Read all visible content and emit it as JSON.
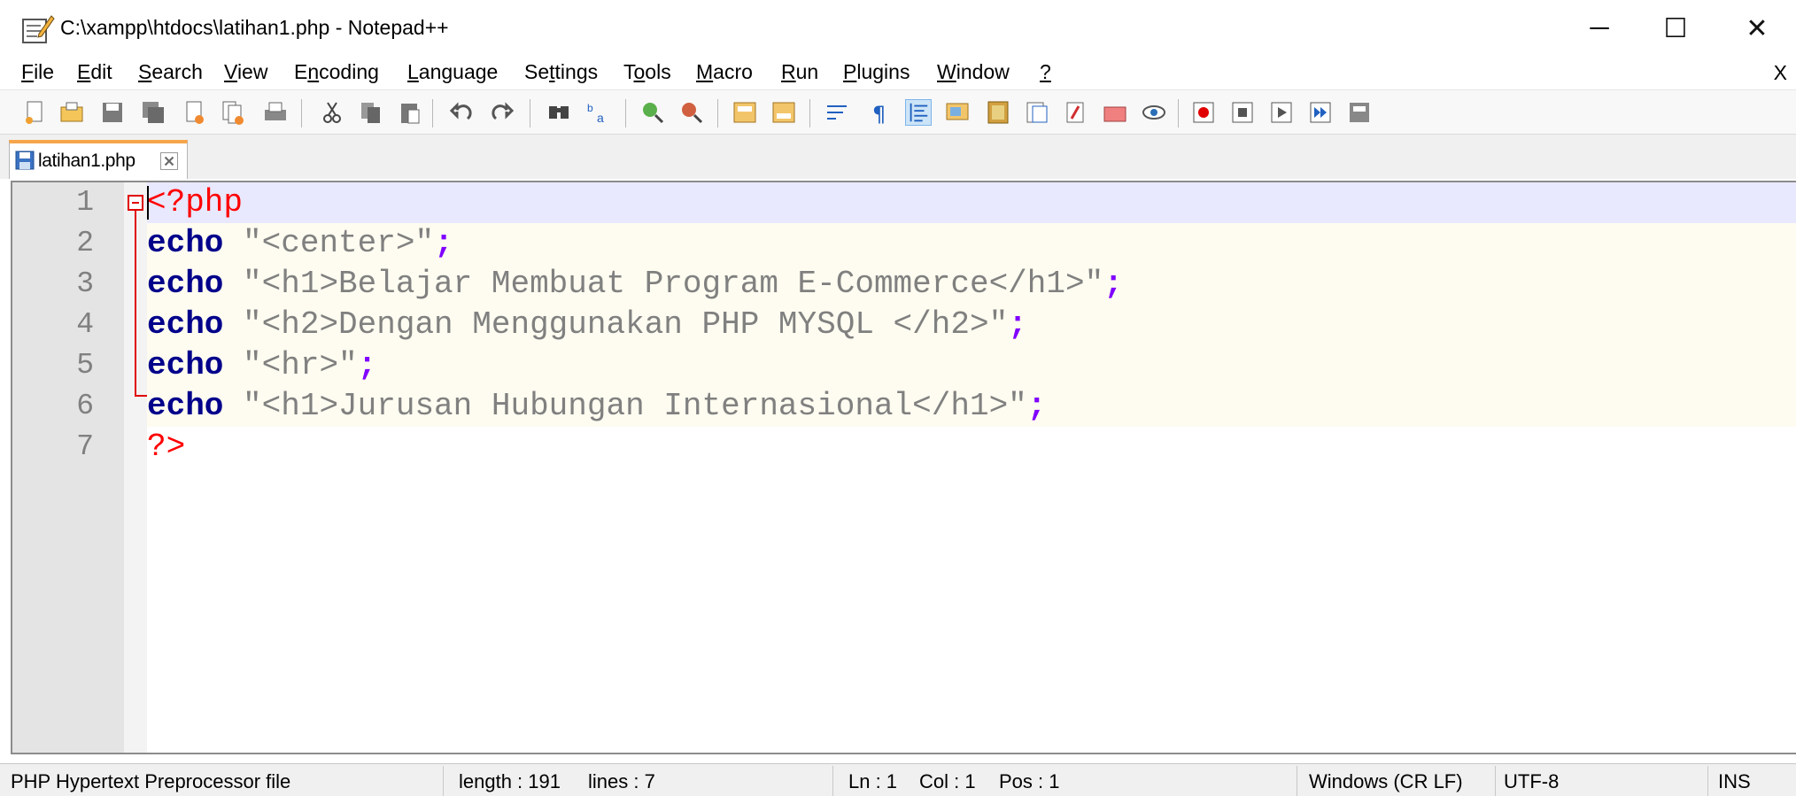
{
  "window": {
    "title": "C:\\xampp\\htdocs\\latihan1.php - Notepad++",
    "minimize_glyph": "─",
    "maximize_glyph": "☐",
    "close_glyph": "✕"
  },
  "menu": {
    "items": [
      {
        "pre": "",
        "u": "F",
        "post": "ile"
      },
      {
        "pre": "",
        "u": "E",
        "post": "dit"
      },
      {
        "pre": "",
        "u": "S",
        "post": "earch"
      },
      {
        "pre": "",
        "u": "V",
        "post": "iew"
      },
      {
        "pre": "E",
        "u": "n",
        "post": "coding"
      },
      {
        "pre": "",
        "u": "L",
        "post": "anguage"
      },
      {
        "pre": "Se",
        "u": "t",
        "post": "tings"
      },
      {
        "pre": "T",
        "u": "o",
        "post": "ols"
      },
      {
        "pre": "",
        "u": "M",
        "post": "acro"
      },
      {
        "pre": "",
        "u": "R",
        "post": "un"
      },
      {
        "pre": "",
        "u": "P",
        "post": "lugins"
      },
      {
        "pre": "",
        "u": "W",
        "post": "indow"
      },
      {
        "pre": "",
        "u": "?",
        "post": ""
      }
    ],
    "close_doc": "X"
  },
  "toolbar": {
    "icons": [
      "new-file-icon",
      "open-file-icon",
      "save-icon",
      "save-all-icon",
      "close-icon",
      "close-all-icon",
      "print-icon",
      "cut-icon",
      "copy-icon",
      "paste-icon",
      "undo-icon",
      "redo-icon",
      "find-icon",
      "replace-icon",
      "zoom-in-icon",
      "zoom-out-icon",
      "sync-vertical-icon",
      "sync-horizontal-icon",
      "word-wrap-icon",
      "show-all-characters-icon",
      "indent-guide-icon",
      "user-defined-language-icon",
      "document-map-icon",
      "function-list-icon",
      "folder-as-workspace-icon",
      "document-list-icon",
      "monitoring-icon",
      "record-macro-icon",
      "stop-macro-icon",
      "play-macro-icon",
      "run-macro-multiple-icon",
      "save-macro-icon"
    ]
  },
  "tab": {
    "label": "latihan1.php"
  },
  "editor": {
    "lines": [
      {
        "num": "1",
        "tokens": [
          {
            "t": "<?php",
            "c": "tag"
          }
        ]
      },
      {
        "num": "2",
        "tokens": [
          {
            "t": "echo",
            "c": "kw"
          },
          {
            "t": " \"<center>\"",
            "c": "str"
          },
          {
            "t": ";",
            "c": "op"
          }
        ]
      },
      {
        "num": "3",
        "tokens": [
          {
            "t": "echo",
            "c": "kw"
          },
          {
            "t": " \"<h1>Belajar Membuat Program E-Commerce</h1>\"",
            "c": "str"
          },
          {
            "t": ";",
            "c": "op"
          }
        ]
      },
      {
        "num": "4",
        "tokens": [
          {
            "t": "echo",
            "c": "kw"
          },
          {
            "t": " \"<h2>Dengan Menggunakan PHP MYSQL </h2>\"",
            "c": "str"
          },
          {
            "t": ";",
            "c": "op"
          }
        ]
      },
      {
        "num": "5",
        "tokens": [
          {
            "t": "echo",
            "c": "kw"
          },
          {
            "t": " \"<hr>\"",
            "c": "str"
          },
          {
            "t": ";",
            "c": "op"
          }
        ]
      },
      {
        "num": "6",
        "tokens": [
          {
            "t": "echo",
            "c": "kw"
          },
          {
            "t": " \"<h1>Jurusan Hubungan Internasional</h1>\"",
            "c": "str"
          },
          {
            "t": ";",
            "c": "op"
          }
        ]
      },
      {
        "num": "7",
        "tokens": [
          {
            "t": "?>",
            "c": "tag"
          }
        ]
      }
    ]
  },
  "status": {
    "file_type": "PHP Hypertext Preprocessor file",
    "length": "length : 191",
    "lines": "lines : 7",
    "ln": "Ln : 1",
    "col": "Col : 1",
    "pos": "Pos : 1",
    "eol": "Windows (CR LF)",
    "encoding": "UTF-8",
    "mode": "INS"
  },
  "colors": {
    "keyword": "#00008b",
    "string": "#808080",
    "operator": "#8000ff",
    "php_tag": "#ff0000",
    "current_line": "#e8e8ff",
    "tab_accent": "#f7a54a"
  }
}
